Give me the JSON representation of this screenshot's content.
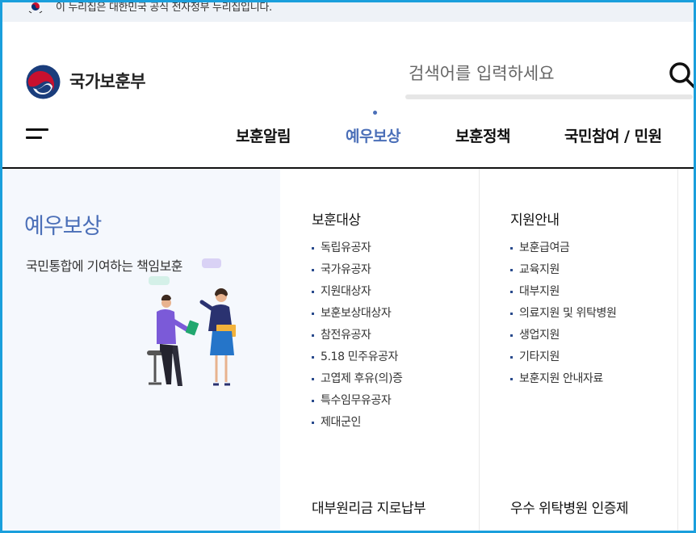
{
  "gov_notice": "이 누리집은 대한민국 공식 전자정부 누리집입니다.",
  "header": {
    "brand_name": "국가보훈부",
    "search_placeholder": "검색어를 입력하세요"
  },
  "nav": {
    "items": [
      {
        "label": "보훈알림",
        "active": false
      },
      {
        "label": "예우보상",
        "active": true
      },
      {
        "label": "보훈정책",
        "active": false
      },
      {
        "label": "국민참여 / 민원",
        "active": false
      }
    ]
  },
  "mega": {
    "title": "예우보상",
    "description": "국민통합에 기여하는 책임보훈",
    "columns": [
      {
        "heading": "보훈대상",
        "items": [
          "독립유공자",
          "국가유공자",
          "지원대상자",
          "보훈보상대상자",
          "참전유공자",
          "5.18 민주유공자",
          "고엽제 후유(의)증",
          "특수임무유공자",
          "제대군인"
        ],
        "footer_heading": "대부원리금 지로납부"
      },
      {
        "heading": "지원안내",
        "items": [
          "보훈급여금",
          "교육지원",
          "대부지원",
          "의료지원 및 위탁병원",
          "생업지원",
          "기타지원",
          "보훈지원 안내자료"
        ],
        "footer_heading": "우수 위탁병원 인증제"
      }
    ]
  },
  "colors": {
    "accent": "#4b6fb8",
    "frame": "#1a9fdc",
    "panel_bg": "#f5f8fd"
  }
}
